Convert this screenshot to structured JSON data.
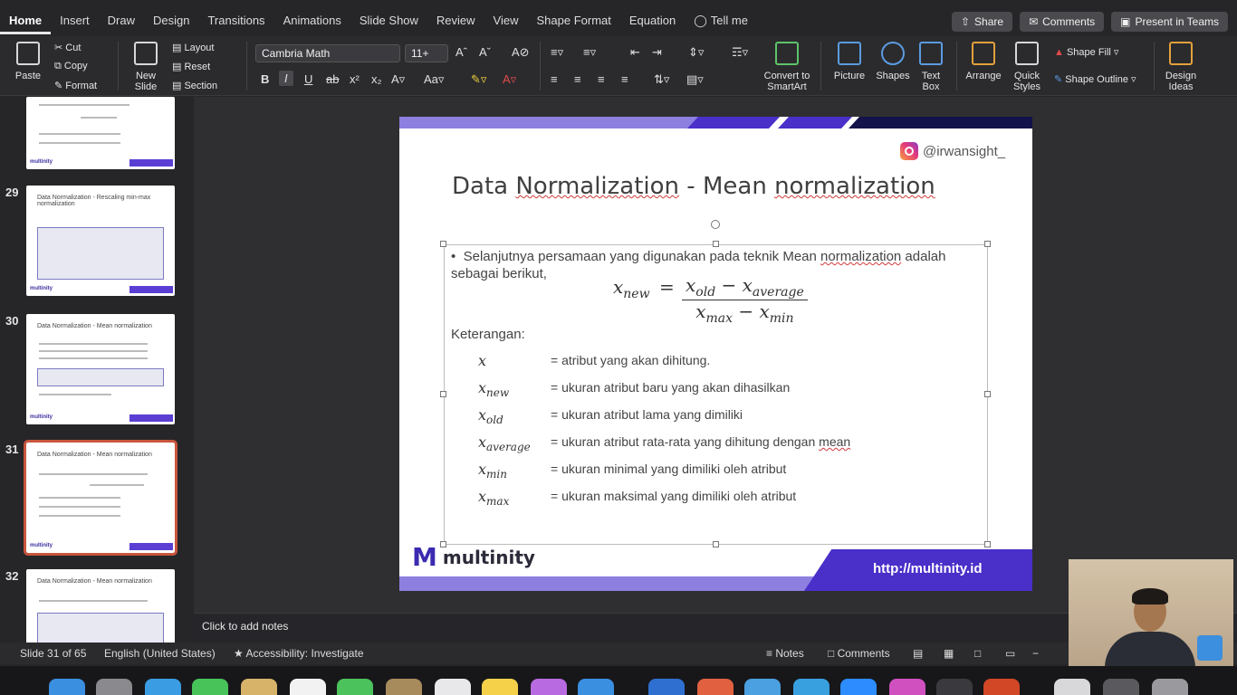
{
  "tabs": [
    "Home",
    "Insert",
    "Draw",
    "Design",
    "Transitions",
    "Animations",
    "Slide Show",
    "Review",
    "View",
    "Shape Format",
    "Equation"
  ],
  "tell_me": "Tell me",
  "top_buttons": {
    "share": "Share",
    "comments": "Comments",
    "present": "Present in Teams"
  },
  "ribbon": {
    "paste": "Paste",
    "cut": "Cut",
    "copy": "Copy",
    "format": "Format",
    "new_slide": "New Slide",
    "layout": "Layout",
    "reset": "Reset",
    "section": "Section",
    "font_name": "Cambria Math",
    "font_size": "11+",
    "convert": "Convert to SmartArt",
    "picture": "Picture",
    "shapes": "Shapes",
    "text_box": "Text Box",
    "arrange": "Arrange",
    "quick_styles": "Quick Styles",
    "shape_fill": "Shape Fill",
    "shape_outline": "Shape Outline",
    "design_ideas": "Design Ideas"
  },
  "thumbnails": [
    {
      "number": "29",
      "title": "Data Normalization - Rescaling min-max normalization"
    },
    {
      "number": "30",
      "title": "Data Normalization - Mean normalization"
    },
    {
      "number": "31",
      "title": "Data Normalization - Mean normalization"
    },
    {
      "number": "32",
      "title": "Data Normalization - Mean normalization"
    }
  ],
  "slide": {
    "instagram": "@irwansight_",
    "title_pre": "Data ",
    "title_w1": "Normalization",
    "title_mid": " - Mean ",
    "title_w2": "normalization",
    "bullet_pre": "Selanjutnya persamaan yang digunakan pada teknik Mean ",
    "bullet_u": "normalization",
    "bullet_post": " adalah sebagai berikut,",
    "formula": {
      "lhs": "x",
      "lhs_sub": "new",
      "eq": "=",
      "num_a": "x",
      "num_a_sub": "old",
      "minus": "−",
      "num_b": "x",
      "num_b_sub": "average",
      "den_a": "x",
      "den_a_sub": "max",
      "den_b": "x",
      "den_b_sub": "min"
    },
    "keterangan": "Keterangan:",
    "definitions": [
      {
        "sym": "x",
        "sub": "",
        "text": "= atribut yang akan dihitung."
      },
      {
        "sym": "x",
        "sub": "new",
        "text": "= ukuran atribut baru yang akan dihasilkan"
      },
      {
        "sym": "x",
        "sub": "old",
        "text": "= ukuran atribut lama yang dimiliki"
      },
      {
        "sym": "x",
        "sub": "average",
        "text": "= ukuran atribut rata-rata yang dihitung dengan ",
        "u": "mean"
      },
      {
        "sym": "x",
        "sub": "min",
        "text": "= ukuran minimal yang dimiliki oleh atribut"
      },
      {
        "sym": "x",
        "sub": "max",
        "text": "= ukuran maksimal yang dimiliki oleh atribut"
      }
    ],
    "logo_mark": "M",
    "logo_text": "multinity",
    "footer_url": "http://multinity.id"
  },
  "notes_placeholder": "Click to add notes",
  "status": {
    "slide": "Slide 31 of 65",
    "language": "English (United States)",
    "accessibility": "Accessibility: Investigate",
    "notes": "Notes",
    "comments": "Comments"
  },
  "colors": {
    "accent": "#4a2fc9",
    "selected_thumb": "#c8553d",
    "ribbon_bg": "#2b2b2e"
  }
}
